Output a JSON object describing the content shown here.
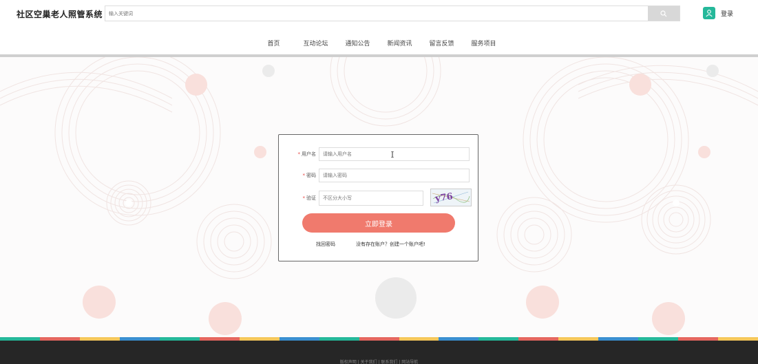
{
  "header": {
    "site_title": "社区空巢老人照管系统",
    "search_placeholder": "输入关键词",
    "login_label": "登录"
  },
  "nav": {
    "items": [
      {
        "label": "首页",
        "color": "#25b89a"
      },
      {
        "label": "互动论坛",
        "color": "#e5675f"
      },
      {
        "label": "通知公告",
        "color": "#f5c75a"
      },
      {
        "label": "新闻资讯",
        "color": "#3a8fd0"
      },
      {
        "label": "留言反馈",
        "color": "#25b89a"
      },
      {
        "label": "服务项目",
        "color": "#e5675f"
      }
    ]
  },
  "login_form": {
    "username_label": "用户名",
    "username_placeholder": "请输入用户名",
    "password_label": "密码",
    "password_placeholder": "请输入密码",
    "captcha_label": "验证",
    "captcha_placeholder": "不区分大小写",
    "captcha_text": "y76",
    "submit_label": "立即登录",
    "forgot_link": "找回密码",
    "register_link": "没有存在账户？创建一个账户吧!"
  },
  "footer": {
    "links": "版权声明 | 关于我们 | 联系我们 | 网站导航",
    "stripe_colors": [
      "#25b89a",
      "#e5675f",
      "#f5c75a",
      "#3a8fd0"
    ]
  },
  "colors": {
    "accent": "#f07a6d",
    "brand_green": "#25b89a",
    "footer_bg": "#262626"
  }
}
